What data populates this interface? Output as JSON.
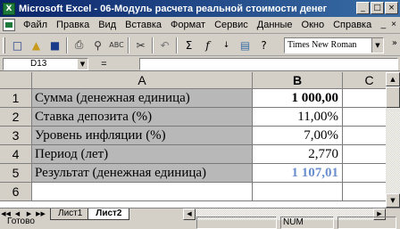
{
  "window": {
    "title": "Microsoft Excel - 06-Модуль расчета реальной стоимости денег",
    "app_icon_letter": "X",
    "controls": [
      "_",
      "□",
      "×"
    ]
  },
  "menu": {
    "items": [
      "Файл",
      "Правка",
      "Вид",
      "Вставка",
      "Формат",
      "Сервис",
      "Данные",
      "Окно",
      "Справка"
    ],
    "right_controls": [
      "_",
      "×"
    ]
  },
  "toolbar": {
    "icons": [
      "new-icon",
      "open-icon",
      "save-icon",
      "print-icon",
      "print-preview-icon",
      "spelling-icon",
      "cut-icon",
      "undo-icon",
      "sum-icon",
      "function-icon",
      "sort-icon",
      "chart-wizard-icon",
      "help-icon"
    ],
    "font_name": "Times New Roman",
    "more": "»"
  },
  "formula_bar": {
    "cell_ref": "D13",
    "fx": "=",
    "formula": ""
  },
  "sheet": {
    "columns": [
      "A",
      "B",
      "C"
    ],
    "rows": [
      {
        "num": "1",
        "label": "Сумма (денежная единица)",
        "value": "1 000,00"
      },
      {
        "num": "2",
        "label": "Ставка депозита (%)",
        "value": "11,00%"
      },
      {
        "num": "3",
        "label": "Уровень инфляции (%)",
        "value": "7,00%"
      },
      {
        "num": "4",
        "label": "Период (лет)",
        "value": "2,770"
      },
      {
        "num": "5",
        "label": "Результат (денежная единица)",
        "value": "1 107,01"
      },
      {
        "num": "6",
        "label": "",
        "value": ""
      }
    ],
    "result_color": "#6a8fcf"
  },
  "tabs": {
    "items": [
      "Лист1",
      "Лист2"
    ],
    "active": "Лист2"
  },
  "status": {
    "ready": "Готово",
    "num": "NUM"
  }
}
